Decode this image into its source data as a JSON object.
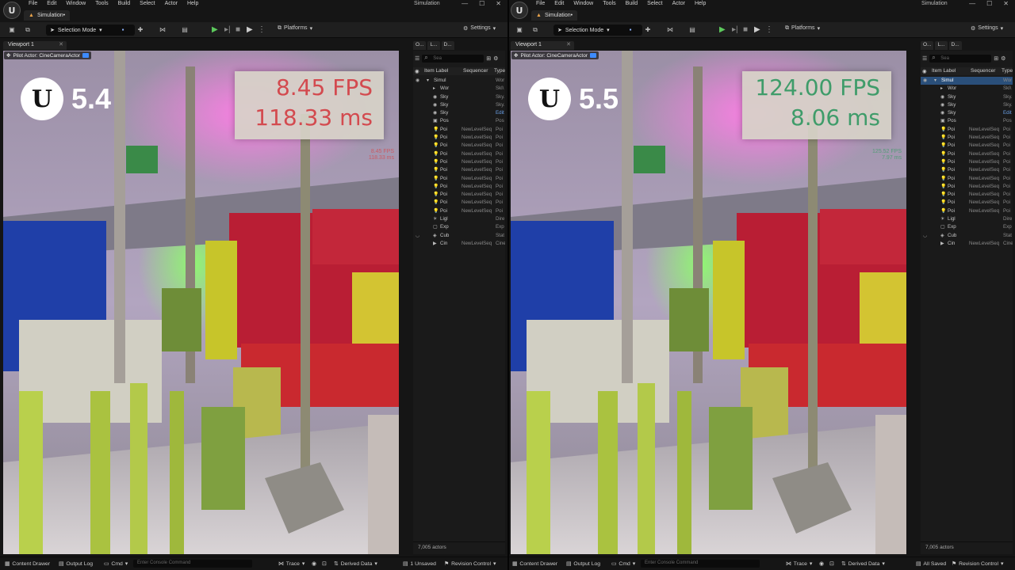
{
  "menu": [
    "File",
    "Edit",
    "Window",
    "Tools",
    "Build",
    "Select",
    "Actor",
    "Help"
  ],
  "window_title": "Simulation",
  "window_controls": [
    "—",
    "☐",
    "✕"
  ],
  "doc_tab": "Simulation•",
  "toolbar": {
    "mode_label": "Selection Mode",
    "platforms_label": "Platforms",
    "settings_label": "Settings"
  },
  "viewport": {
    "tab_label": "Viewport 1",
    "pilot_label": "Pilot Actor: CineCameraActor"
  },
  "outliner": {
    "tabs": [
      "O...",
      "L...",
      "D..."
    ],
    "search_placeholder": "Sea",
    "columns": {
      "label": "Item Label",
      "sequencer": "Sequencer",
      "type": "Type"
    },
    "rows": [
      {
        "label": "Simul",
        "seq": "",
        "type": "Wor",
        "indent": 0,
        "icon": "▾",
        "sel": true
      },
      {
        "label": "Wor",
        "seq": "",
        "type": "Skl\\",
        "indent": 1,
        "icon": "▸"
      },
      {
        "label": "Sky",
        "seq": "",
        "type": "Sky.",
        "indent": 1,
        "icon": "◉"
      },
      {
        "label": "Sky",
        "seq": "",
        "type": "Sky.",
        "indent": 1,
        "icon": "◉"
      },
      {
        "label": "Sky",
        "seq": "",
        "type": "Edit",
        "indent": 1,
        "icon": "◉",
        "edit": true
      },
      {
        "label": "Pos",
        "seq": "",
        "type": "Pos",
        "indent": 1,
        "icon": "▣"
      },
      {
        "label": "Poi",
        "seq": "NewLevelSeq",
        "type": "Poi",
        "indent": 1,
        "icon": "💡"
      },
      {
        "label": "Poi",
        "seq": "NewLevelSeq",
        "type": "Poi",
        "indent": 1,
        "icon": "💡"
      },
      {
        "label": "Poi",
        "seq": "NewLevelSeq",
        "type": "Poi",
        "indent": 1,
        "icon": "💡"
      },
      {
        "label": "Poi",
        "seq": "NewLevelSeq",
        "type": "Poi",
        "indent": 1,
        "icon": "💡"
      },
      {
        "label": "Poi",
        "seq": "NewLevelSeq",
        "type": "Poi",
        "indent": 1,
        "icon": "💡"
      },
      {
        "label": "Poi",
        "seq": "NewLevelSeq",
        "type": "Poi",
        "indent": 1,
        "icon": "💡"
      },
      {
        "label": "Poi",
        "seq": "NewLevelSeq",
        "type": "Poi",
        "indent": 1,
        "icon": "💡"
      },
      {
        "label": "Poi",
        "seq": "NewLevelSeq",
        "type": "Poi",
        "indent": 1,
        "icon": "💡"
      },
      {
        "label": "Poi",
        "seq": "NewLevelSeq",
        "type": "Poi",
        "indent": 1,
        "icon": "💡"
      },
      {
        "label": "Poi",
        "seq": "NewLevelSeq",
        "type": "Poi",
        "indent": 1,
        "icon": "💡"
      },
      {
        "label": "Poi",
        "seq": "NewLevelSeq",
        "type": "Poi",
        "indent": 1,
        "icon": "💡"
      },
      {
        "label": "Ligl",
        "seq": "",
        "type": "Dire",
        "indent": 1,
        "icon": "☀"
      },
      {
        "label": "Exp",
        "seq": "",
        "type": "Exp",
        "indent": 1,
        "icon": "▢"
      },
      {
        "label": "Cub",
        "seq": "",
        "type": "Stat",
        "indent": 1,
        "icon": "◈"
      },
      {
        "label": "Cin",
        "seq": "NewLevelSeq",
        "type": "Cine",
        "indent": 1,
        "icon": "▶"
      }
    ],
    "actor_count": "7,005 actors"
  },
  "left": {
    "version": "5.4",
    "fps": "8.45 FPS",
    "ms": "118.33 ms",
    "fps_small": "8.45 FPS",
    "ms_small": "118.33 ms",
    "fps_color": "#d34a4f",
    "unsaved": "1 Unsaved"
  },
  "right": {
    "version": "5.5",
    "fps": "124.00 FPS",
    "ms": "8.06 ms",
    "fps_small": "125.52 FPS",
    "ms_small": "7.97 ms",
    "fps_color": "#3f9c6a",
    "saved": "All Saved"
  },
  "statusbar": {
    "content_drawer": "Content Drawer",
    "output_log": "Output Log",
    "cmd": "Cmd",
    "console_placeholder": "Enter Console Command",
    "trace": "Trace",
    "derived_data": "Derived Data",
    "revision_control": "Revision Control"
  }
}
